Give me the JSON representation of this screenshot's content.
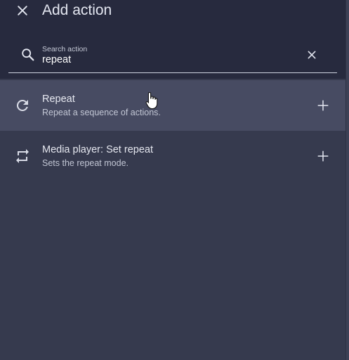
{
  "header": {
    "title": "Add action",
    "close_icon": "close-icon"
  },
  "search": {
    "label": "Search action",
    "value": "repeat",
    "search_icon": "search-icon",
    "clear_icon": "clear-icon"
  },
  "results": [
    {
      "title": "Repeat",
      "description": "Repeat a sequence of actions.",
      "icon": "refresh-icon",
      "add_icon": "plus-icon",
      "hovered": true
    },
    {
      "title": "Media player: Set repeat",
      "description": "Sets the repeat mode.",
      "icon": "repeat-icon",
      "add_icon": "plus-icon",
      "hovered": false
    }
  ],
  "colors": {
    "header_bg": "#272a3e",
    "panel_bg": "#363a4e",
    "hover_bg": "#474b62",
    "text_primary": "#e6e8f0",
    "text_secondary": "#c2c6d4"
  }
}
